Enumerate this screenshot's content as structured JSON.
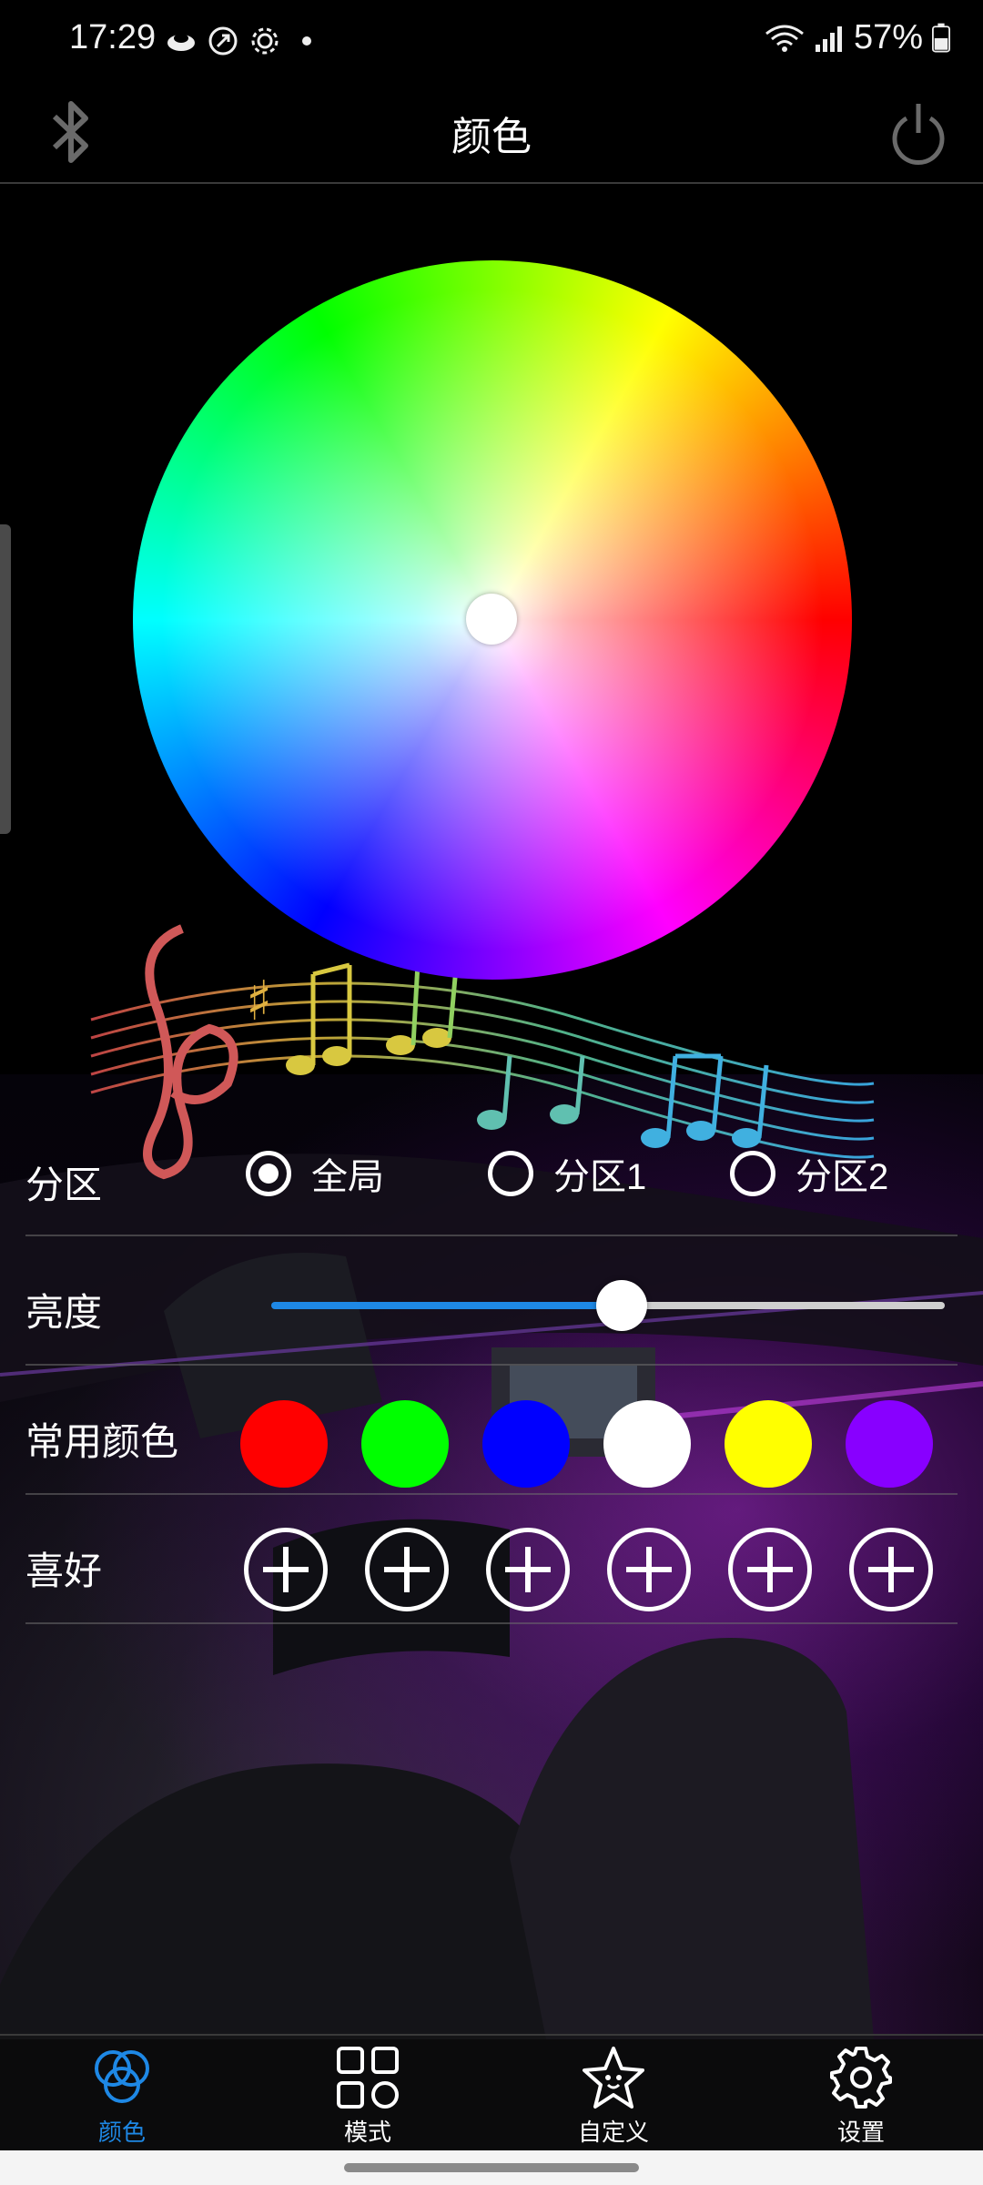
{
  "status_bar": {
    "time": "17:29",
    "battery": "57%"
  },
  "header": {
    "title": "颜色"
  },
  "zone": {
    "label": "分区",
    "options": [
      {
        "label": "全局",
        "checked": true
      },
      {
        "label": "分区1",
        "checked": false
      },
      {
        "label": "分区2",
        "checked": false
      }
    ]
  },
  "brightness": {
    "label": "亮度",
    "value_fraction": 0.52
  },
  "common_colors": {
    "label": "常用颜色",
    "swatches": [
      "#ff0000",
      "#00ff00",
      "#0000ff",
      "#ffffff",
      "#ffff00",
      "#8800ff"
    ]
  },
  "favorites": {
    "label": "喜好",
    "count": 6
  },
  "bottom_nav": {
    "items": [
      {
        "label": "颜色",
        "icon": "color-circles-icon",
        "active": true
      },
      {
        "label": "模式",
        "icon": "grid-icon",
        "active": false
      },
      {
        "label": "自定义",
        "icon": "star-icon",
        "active": false
      },
      {
        "label": "设置",
        "icon": "gear-icon",
        "active": false
      }
    ],
    "accent_color": "#1e88e5"
  }
}
